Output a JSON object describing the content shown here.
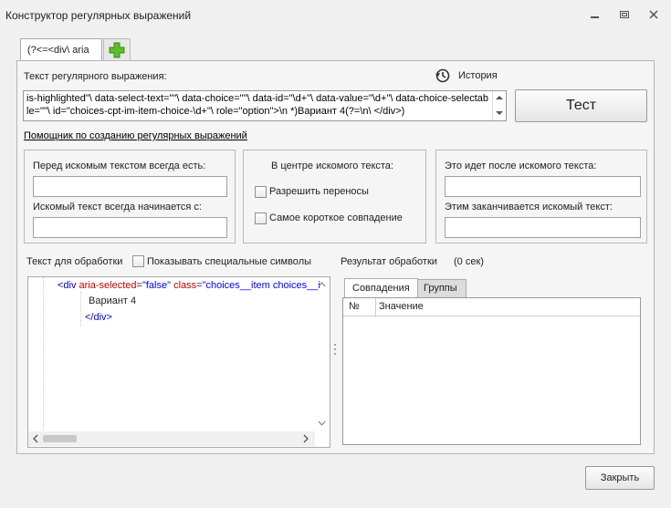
{
  "window": {
    "title": "Конструктор регулярных выражений",
    "minimize_glyph": "▭",
    "restore_glyph": "⧉",
    "close_glyph": "✕"
  },
  "tabs": [
    {
      "label": "(?<=<div\\ aria"
    }
  ],
  "add_tab_icon": "plus-icon",
  "regex": {
    "label": "Текст регулярного выражения:",
    "history_label": "История",
    "text": "is-highlighted\"\\ data-select-text=\"\"\\ data-choice=\"\"\\ data-id=\"\\d+\"\\ data-value=\"\\d+\"\\ data-choice-selectable=\"\"\\ id=\"choices-cpt-im-item-choice-\\d+\"\\ role=\"option\">\\n *)Вариант 4(?=\\n\\ </div>)",
    "test_button": "Тест"
  },
  "helper_link": "Помощник по созданию регулярных выражений",
  "before_group": {
    "label1": "Перед искомым текстом всегда есть:",
    "value1": "",
    "label2": "Искомый текст всегда начинается с:",
    "value2": ""
  },
  "center_group": {
    "title": "В центре искомого текста:",
    "checkbox1": "Разрешить переносы",
    "checkbox1_checked": false,
    "checkbox2": "Самое короткое совпадение",
    "checkbox2_checked": false
  },
  "after_group": {
    "label1": "Это идет после искомого текста:",
    "value1": "",
    "label2": "Этим заканчивается искомый текст:",
    "value2": ""
  },
  "source": {
    "label": "Текст для обработки",
    "special_chars_label": "Показывать специальные символы",
    "special_chars_checked": false,
    "line1_tag_open": "<div ",
    "line1_attr1": "aria-selected",
    "line1_eq1": "=",
    "line1_val1": "\"false\"",
    "line1_attr2": " class",
    "line1_eq2": "=",
    "line1_val2": "\"choices__item choices__i",
    "line2": "Вариант 4",
    "line3": "</div>"
  },
  "result": {
    "label": "Результат обработки",
    "time": "(0 сек)",
    "tabs": [
      "Совпадения",
      "Группы"
    ],
    "active_tab": "Совпадения",
    "columns": [
      "№",
      "Значение"
    ],
    "rows": []
  },
  "close_button": "Закрыть",
  "colors": {
    "plus_icon": "#4caf2a",
    "tag": "#0000c0",
    "attr": "#c00000",
    "value": "#0000ff"
  }
}
